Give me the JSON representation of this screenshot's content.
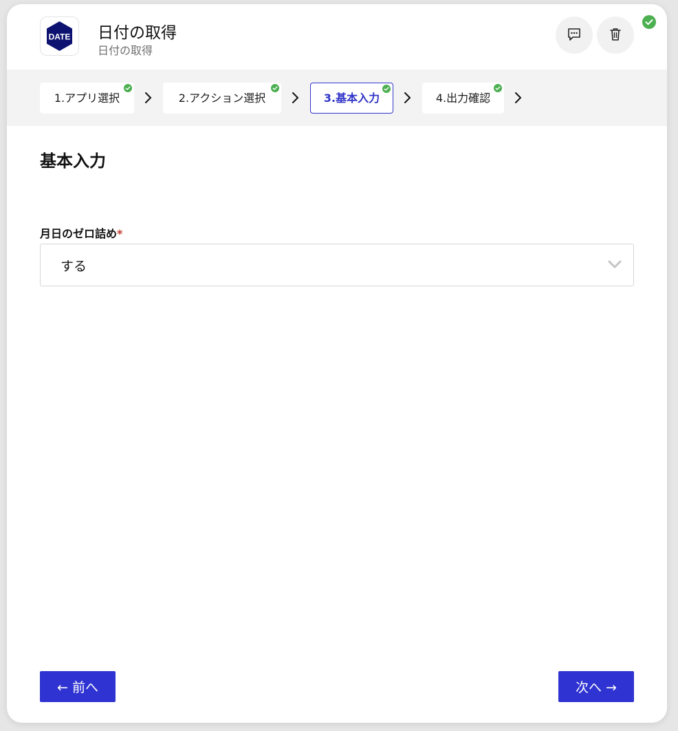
{
  "header": {
    "logo_text": "DATE",
    "title": "日付の取得",
    "subtitle": "日付の取得",
    "icons": [
      "comment-icon",
      "trash-icon",
      "check-circle-icon"
    ]
  },
  "steps": [
    {
      "label": "1.アプリ選択",
      "completed": true,
      "active": false
    },
    {
      "label": "2.アクション選択",
      "completed": true,
      "active": false
    },
    {
      "label": "3.基本入力",
      "completed": true,
      "active": true
    },
    {
      "label": "4.出力確認",
      "completed": true,
      "active": false
    }
  ],
  "main": {
    "section_title": "基本入力",
    "field_label": "月日のゼロ詰め",
    "required_mark": "*",
    "select_value": "する"
  },
  "footer": {
    "prev_label": "← 前へ",
    "next_label": "次へ →"
  },
  "colors": {
    "accent": "#2f33d1",
    "success": "#4caf50",
    "logo_bg": "#0d1170"
  }
}
